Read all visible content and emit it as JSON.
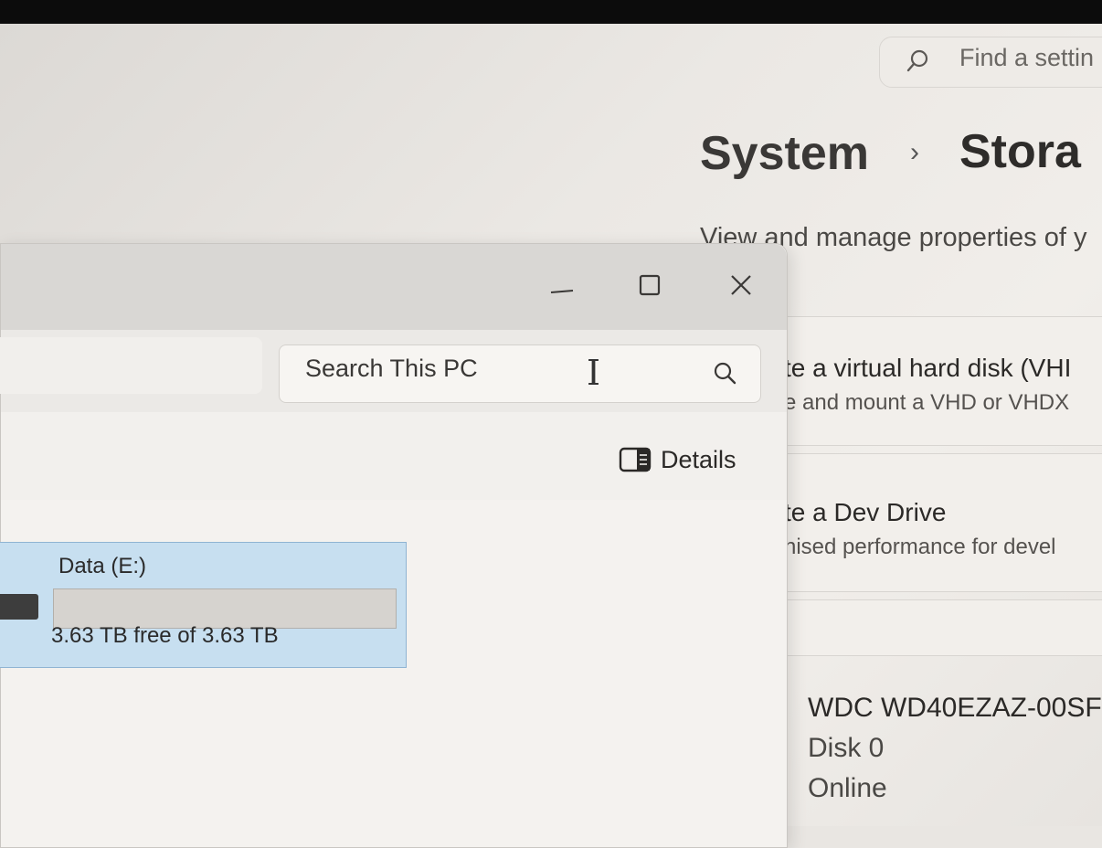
{
  "settings": {
    "search_placeholder": "Find a settin",
    "breadcrumb": {
      "parent": "System",
      "separator": "›",
      "current": "Stora"
    },
    "description": "View and manage properties of y",
    "cards": [
      {
        "title": "te a virtual hard disk (VHI",
        "subtitle": "e and mount a VHD or VHDX"
      },
      {
        "title": "te a Dev Drive",
        "subtitle": "nised performance for devel"
      }
    ],
    "disk": {
      "model": "WDC WD40EZAZ-00SF",
      "number": "Disk 0",
      "status": "Online"
    }
  },
  "explorer": {
    "search_placeholder": "Search This PC",
    "details_label": "Details",
    "drive": {
      "name": "Data (E:)",
      "free_text": "3.63 TB free of 3.63 TB",
      "used_fraction": 0
    },
    "icons": {
      "minimize": "minimize-icon",
      "maximize": "maximize-icon",
      "close": "close-icon",
      "search": "search-icon",
      "details": "details-pane-icon",
      "drive": "hard-drive-icon"
    }
  }
}
